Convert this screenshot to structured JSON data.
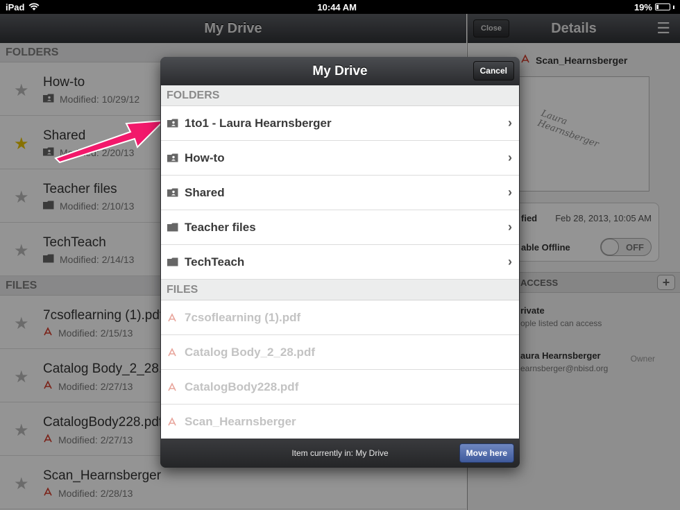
{
  "status_bar": {
    "device": "iPad",
    "time": "10:44 AM",
    "battery": "19%",
    "battery_level": 0.19
  },
  "left_pane": {
    "title": "My Drive",
    "folders_header": "FOLDERS",
    "files_header": "FILES",
    "folders": [
      {
        "name": "How-to",
        "modified": "Modified: 10/29/12",
        "starred": false,
        "shared": true
      },
      {
        "name": "Shared",
        "modified": "Modified: 2/20/13",
        "starred": true,
        "shared": true
      },
      {
        "name": "Teacher files",
        "modified": "Modified: 2/10/13",
        "starred": false,
        "shared": false
      },
      {
        "name": "TechTeach",
        "modified": "Modified: 2/14/13",
        "starred": false,
        "shared": false
      }
    ],
    "files": [
      {
        "name": "7csoflearning (1).pdf",
        "modified": "Modified: 2/15/13"
      },
      {
        "name": "Catalog Body_2_28.",
        "modified": "Modified: 2/27/13"
      },
      {
        "name": "CatalogBody228.pdf",
        "modified": "Modified: 2/27/13"
      },
      {
        "name": "Scan_Hearnsberger",
        "modified": "Modified: 2/28/13"
      }
    ]
  },
  "details": {
    "close_label": "Close",
    "title": "Details",
    "file_name": "Scan_Hearnsberger",
    "signature": "Laura Hearnsberger",
    "modified_label": "fied",
    "modified_value": "Feb 28, 2013, 10:05 AM",
    "offline_label": "able Offline",
    "offline_toggle": "OFF",
    "access_header": "ACCESS",
    "access": [
      {
        "title": "rivate",
        "sub": "ople listed can access"
      },
      {
        "title": "aura Hearnsberger",
        "sub": "earnsberger@nbisd.org",
        "role": "Owner"
      }
    ]
  },
  "modal": {
    "title": "My Drive",
    "cancel_label": "Cancel",
    "folders_header": "FOLDERS",
    "files_header": "FILES",
    "folders": [
      {
        "name": "1to1 - Laura Hearnsberger",
        "shared": true
      },
      {
        "name": "How-to",
        "shared": true
      },
      {
        "name": "Shared",
        "shared": true
      },
      {
        "name": "Teacher files",
        "shared": false
      },
      {
        "name": "TechTeach",
        "shared": false
      }
    ],
    "files": [
      {
        "name": "7csoflearning (1).pdf"
      },
      {
        "name": "Catalog Body_2_28.pdf"
      },
      {
        "name": "CatalogBody228.pdf"
      },
      {
        "name": "Scan_Hearnsberger"
      }
    ],
    "location_text": "Item currently in: My Drive",
    "move_label": "Move here"
  },
  "colors": {
    "annotation_arrow": "#f2196b",
    "move_button": "#4f69ab",
    "star_on": "#e9c300"
  }
}
